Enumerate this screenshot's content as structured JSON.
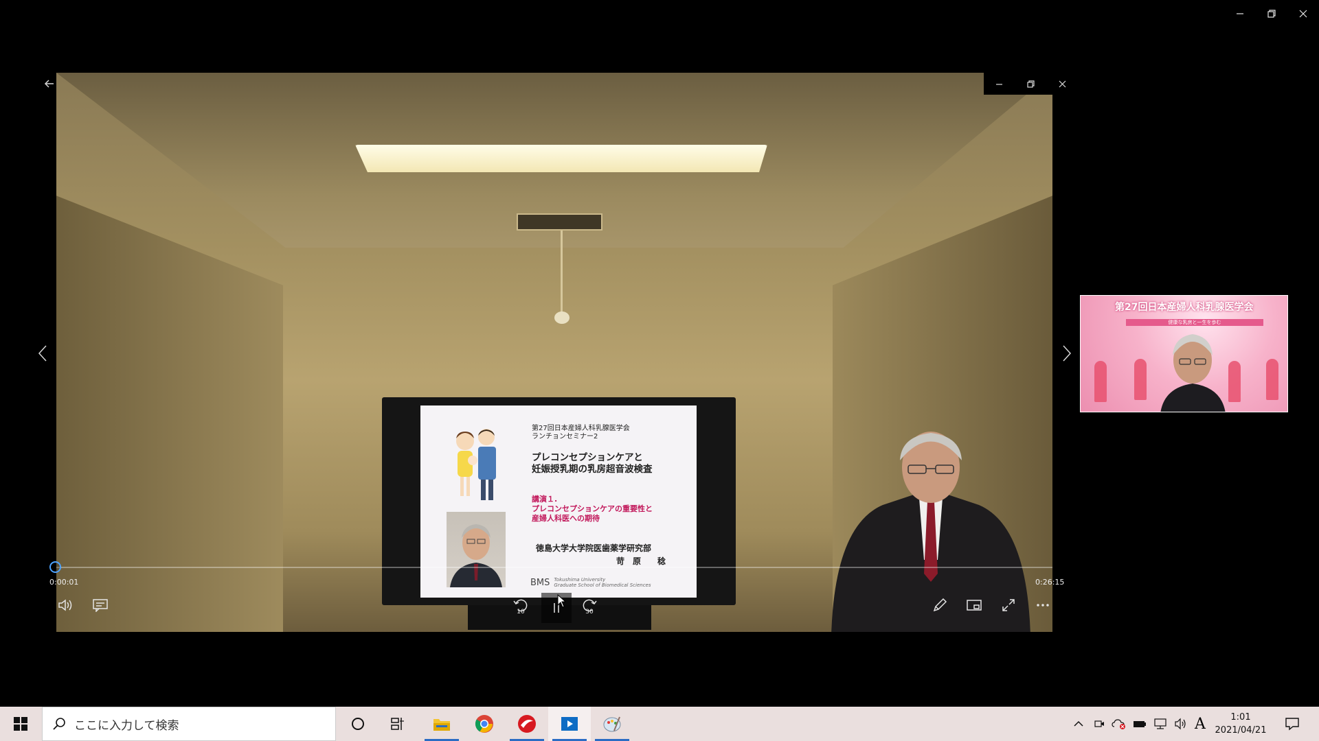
{
  "window": {
    "caption_buttons": [
      "minimize",
      "restore",
      "close"
    ]
  },
  "player": {
    "caption_buttons": [
      "minimize",
      "restore",
      "close"
    ],
    "time_current": "0:00:01",
    "time_total": "0:26:15",
    "progress": 0.0,
    "skip_back_label": "10",
    "skip_forward_label": "30"
  },
  "slide": {
    "subtitle_line1": "第27回日本産婦人科乳腺医学会",
    "subtitle_line2": "ランチョンセミナー2",
    "title_line1": "プレコンセプションケアと",
    "title_line2": "妊娠授乳期の乳房超音波検査",
    "lecture_line1": "講演１.",
    "lecture_line2": "プレコンセプションケアの重要性と",
    "lecture_line3": "産婦人科医への期待",
    "affiliation": "徳島大学大学院医歯薬学研究部",
    "speaker": "苛　原　　稔",
    "logo_text": "BMS",
    "logo_sub1": "Tokushima University",
    "logo_sub2": "Graduate School of Biomedical Sciences"
  },
  "pip": {
    "banner": "第27回日本産婦人科乳腺医学会",
    "sub_banner": "健康な乳房と一生を歩む"
  },
  "taskbar": {
    "search_placeholder": "ここに入力して検索",
    "ime_indicator": "A",
    "time": "1:01",
    "date": "2021/04/21"
  },
  "colors": {
    "accent_blue": "#2b6cc4",
    "progress_thumb": "#4da3ff",
    "slide_accent": "#c2185b",
    "taskbar_bg": "#eadfde"
  }
}
